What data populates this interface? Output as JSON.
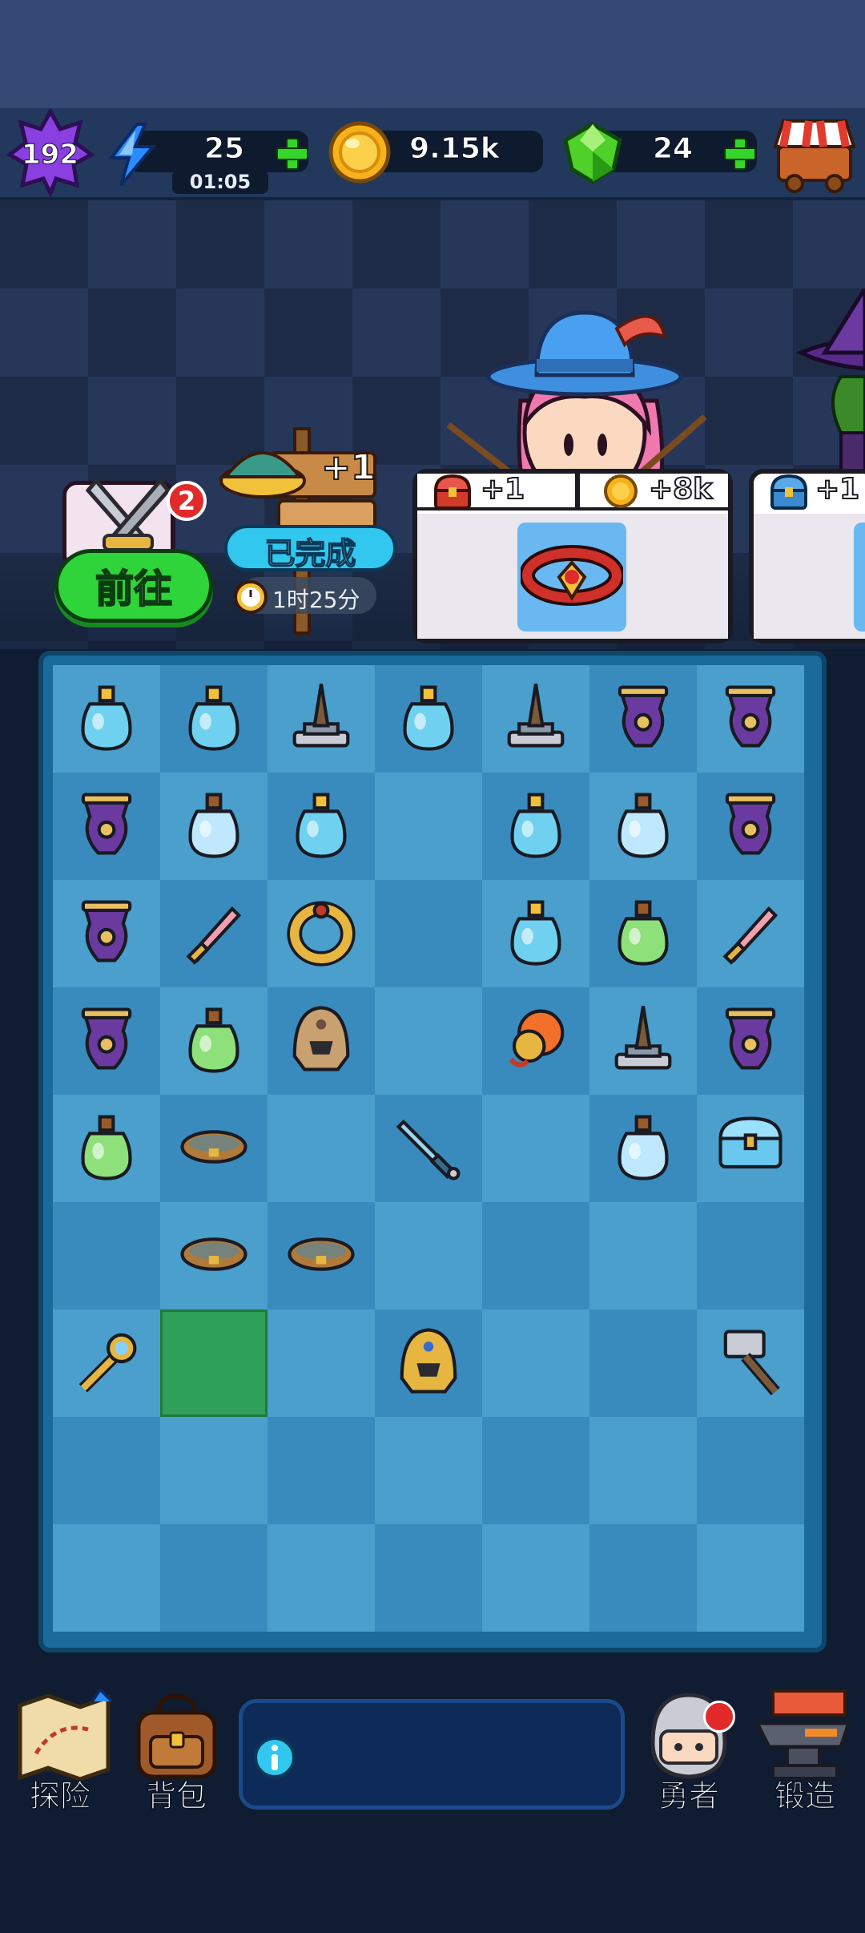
{
  "header": {
    "level": "192",
    "energy": "25",
    "energy_timer": "01:05",
    "gold": "9.15k",
    "gems": "24"
  },
  "quest": {
    "badge_count": "2",
    "go_button": "前往",
    "bonus": "+1",
    "status": "已完成",
    "timer": "1时25分"
  },
  "rewards": [
    {
      "label": "+1",
      "icon": "treasure-chest-icon"
    },
    {
      "label": "+8k",
      "icon": "coin-icon"
    },
    {
      "label": "+1",
      "icon": "blue-chest-icon"
    }
  ],
  "board": {
    "columns": 7,
    "rows": 9,
    "selected": "r7c1",
    "items": {
      "r1": [
        "crystal-potion-icon",
        "tilted-potion-icon",
        "altar-sword-icon",
        "round-potion-icon",
        "altar-dark-icon",
        "purple-cauldron-icon",
        "dark-urn-icon"
      ],
      "r2": [
        "teal-chalice-icon",
        "small-bottle-icon",
        "crystal-potion-icon",
        "",
        "flower-bottle-icon",
        "small-bottle-icon",
        "green-gem-urn-icon"
      ],
      "r3": [
        "golden-vase-icon",
        "pink-dagger-icon",
        "golden-ring-icon",
        "",
        "green-tilted-potion-icon",
        "small-green-bottle-icon",
        "pink-axe-icon"
      ],
      "r4": [
        "maroon-urn-icon",
        "small-green-bottle-icon",
        "knight-helmet-icon",
        "",
        "fire-shield-icon",
        "altar-sword-icon",
        "blue-star-urn-icon"
      ],
      "r5": [
        "small-green-bottle-icon",
        "bronze-bracelet-icon",
        "",
        "ice-sword-icon",
        "",
        "pink-bottle-icon",
        "blue-chest-icon"
      ],
      "r6": [
        "",
        "silver-bracelet-icon",
        "gold-bracelet-icon",
        "",
        "",
        "",
        ""
      ],
      "r7": [
        "golden-scepter-icon",
        "",
        "",
        "golden-helmet-icon",
        "",
        "",
        "war-hammer-icon"
      ],
      "r8": [
        "",
        "",
        "",
        "",
        "",
        "",
        ""
      ],
      "r9": [
        "",
        "",
        "",
        "",
        "",
        "",
        ""
      ]
    }
  },
  "nav": {
    "explore": "探险",
    "backpack": "背包",
    "hero": "勇者",
    "forge": "锻造"
  },
  "colors": {
    "go_green": "#2fd43a",
    "status_cyan": "#31c7ef",
    "gold": "#f6b21a",
    "gem": "#4fd12a",
    "energy": "#2b8bff",
    "level_purple": "#8a3fe0"
  }
}
